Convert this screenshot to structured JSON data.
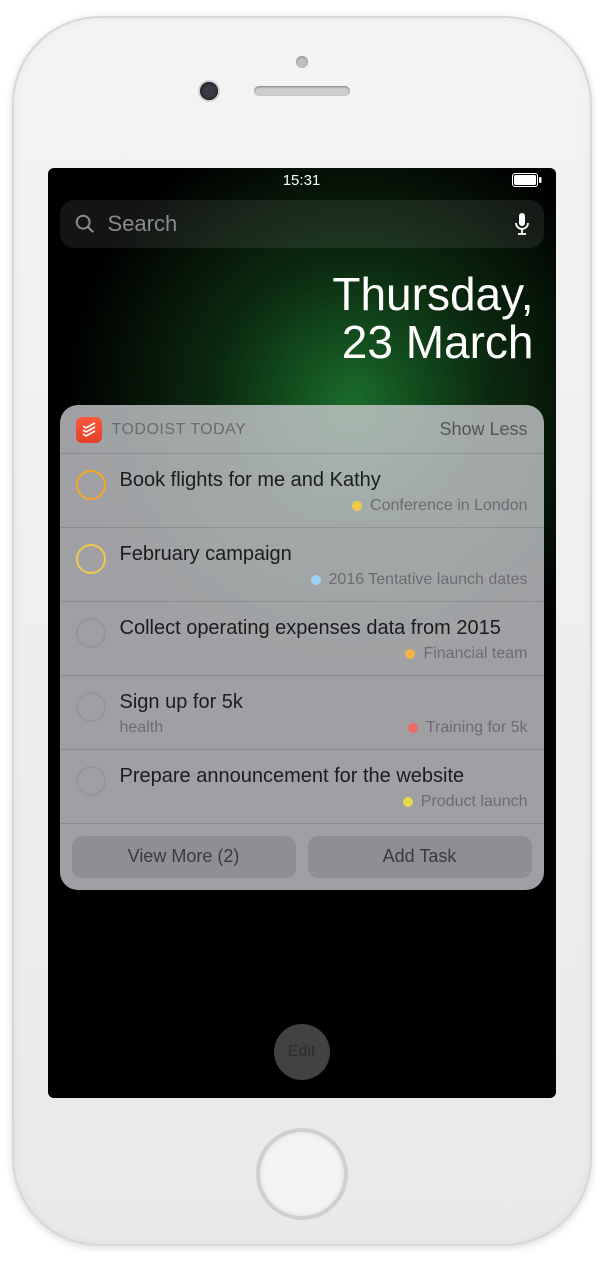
{
  "status": {
    "time": "15:31"
  },
  "search": {
    "placeholder": "Search"
  },
  "date": {
    "day": "Thursday,",
    "date": "23 March"
  },
  "widget": {
    "title": "TODOIST TODAY",
    "toggle": "Show Less",
    "view_more": "View More (2)",
    "add_task": "Add Task"
  },
  "tasks": [
    {
      "title": "Book flights for me and Kathy",
      "sub": "",
      "project": "Conference in London",
      "dot": "#f2c84b",
      "priority": "orange"
    },
    {
      "title": "February campaign",
      "sub": "",
      "project": "2016 Tentative launch dates",
      "dot": "#9fd2f7",
      "priority": "yellow"
    },
    {
      "title": "Collect operating expenses data from 2015",
      "sub": "",
      "project": "Financial team",
      "dot": "#f5b24a",
      "priority": "none"
    },
    {
      "title": "Sign up for 5k",
      "sub": "health",
      "project": "Training for 5k",
      "dot": "#f06a6a",
      "priority": "none"
    },
    {
      "title": "Prepare announcement for the website",
      "sub": "",
      "project": "Product launch",
      "dot": "#e8d94a",
      "priority": "none"
    }
  ],
  "edit": "Edit"
}
